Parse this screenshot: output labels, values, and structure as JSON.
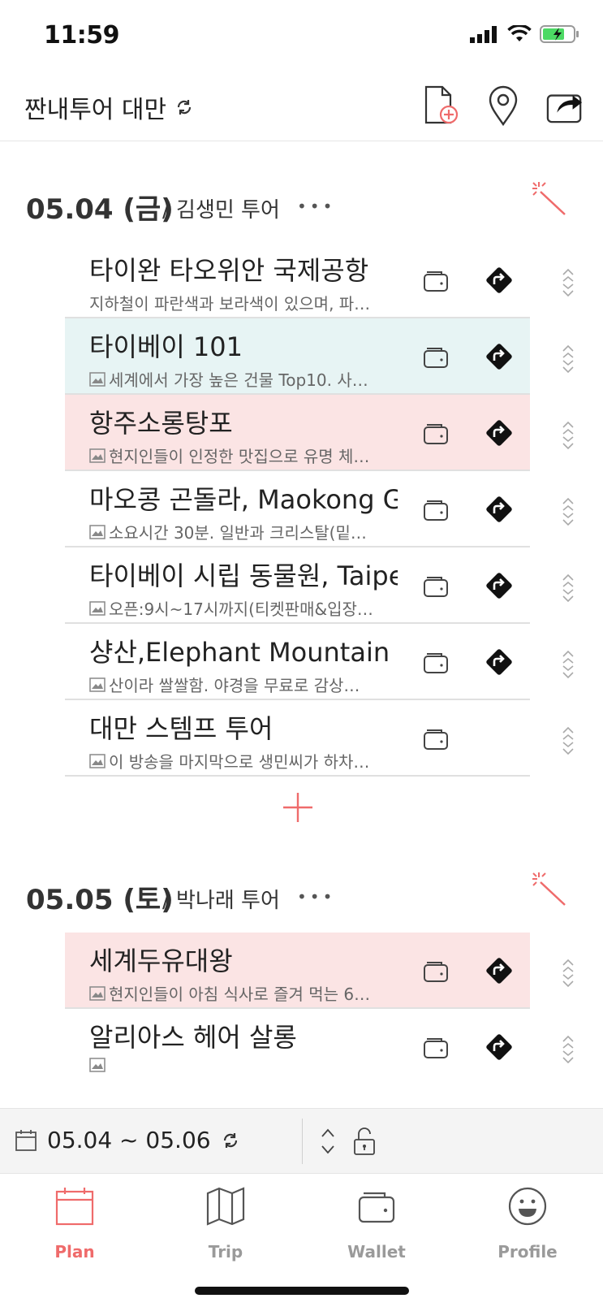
{
  "status_bar": {
    "time": "11:59"
  },
  "header": {
    "title": "짠내투어 대만"
  },
  "days": [
    {
      "date": "05.04 (금)",
      "tour": "/ 김생민 투어",
      "more": "•••",
      "items": [
        {
          "title": "타이완 타오위안 국제공항",
          "desc": "지하철이 파란색과 보라색이 있으며, 파…",
          "color": "none",
          "has_image": false,
          "has_directions": true
        },
        {
          "title": "타이베이 101",
          "desc": "세계에서 가장 높은 건물 Top10. 사…",
          "color": "blue",
          "has_image": true,
          "has_directions": true
        },
        {
          "title": "항주소롱탕포",
          "desc": "현지인들이 인정한 맛집으로 유명 체…",
          "color": "pink",
          "has_image": true,
          "has_directions": true
        },
        {
          "title": "마오콩 곤돌라, Maokong Gondola",
          "desc": "소요시간 30분. 일반과 크리스탈(밑…",
          "color": "none",
          "has_image": true,
          "has_directions": true
        },
        {
          "title": "타이베이 시립 동물원, Taipei Zoo",
          "desc": "오픈:9시~17시까지(티켓판매&입장…",
          "color": "none",
          "has_image": true,
          "has_directions": true
        },
        {
          "title": "샹산,Elephant Mountain",
          "desc": "산이라 쌀쌀함. 야경을 무료로 감상…",
          "color": "none",
          "has_image": true,
          "has_directions": true
        },
        {
          "title": "대만 스템프 투어",
          "desc": "이 방송을 마지막으로 생민씨가 하차…",
          "color": "none",
          "has_image": true,
          "has_directions": false
        }
      ]
    },
    {
      "date": "05.05 (토)",
      "tour": "/ 박나래 투어",
      "more": "•••",
      "items": [
        {
          "title": "세계두유대왕",
          "desc": "현지인들이 아침 식사로 즐겨 먹는 6…",
          "color": "pink",
          "has_image": true,
          "has_directions": true
        },
        {
          "title": "알리아스 헤어 살롱",
          "desc": "",
          "color": "none",
          "has_image": true,
          "has_directions": true
        }
      ]
    }
  ],
  "bottom_toolbar": {
    "date_range": "05.04 ~ 05.06"
  },
  "tabs": [
    {
      "label": "Plan",
      "active": true
    },
    {
      "label": "Trip",
      "active": false
    },
    {
      "label": "Wallet",
      "active": false
    },
    {
      "label": "Profile",
      "active": false
    }
  ],
  "colors": {
    "accent": "#ef6b6b",
    "blue_row": "#e7f4f4",
    "pink_row": "#fbe4e4"
  }
}
